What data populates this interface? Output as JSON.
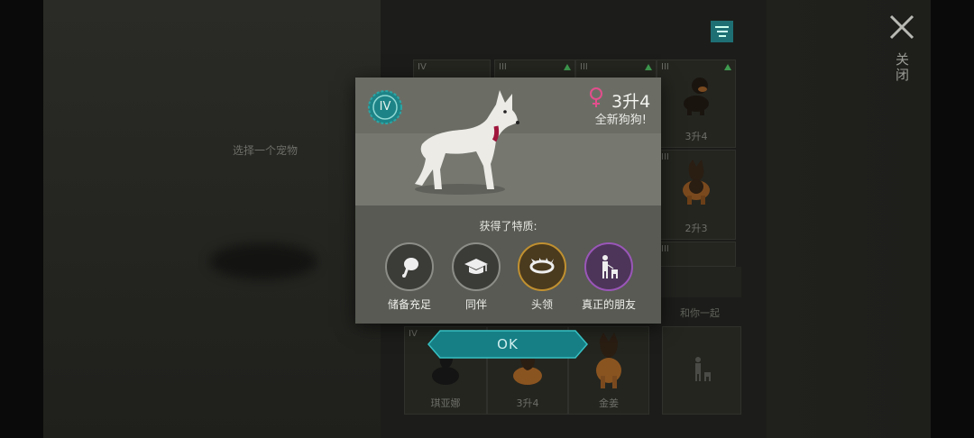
{
  "left": {
    "hint": "选择一个宠物"
  },
  "top_right": {
    "close_label": "关闭"
  },
  "grid": {
    "cards": [
      {
        "tier": "IV",
        "name": ""
      },
      {
        "tier": "III",
        "name": ""
      },
      {
        "tier": "III",
        "name": ""
      },
      {
        "tier": "III",
        "name": "3升4"
      },
      {
        "tier": "III",
        "name": "2升3"
      },
      {
        "tier": "III",
        "name": ""
      },
      {
        "tier": "IV",
        "name": "琪亚娜"
      },
      {
        "tier": "",
        "name": "3升4"
      },
      {
        "tier": "",
        "name": "金姜"
      }
    ],
    "together_label": "和你一起"
  },
  "modal": {
    "tier": "IV",
    "dog_name": "3升4",
    "subtitle": "全新狗狗!",
    "traits_title": "获得了特质:",
    "traits": [
      {
        "label": "储备充足",
        "icon": "meat-icon"
      },
      {
        "label": "同伴",
        "icon": "graduation-cap-icon"
      },
      {
        "label": "头领",
        "icon": "spiked-collar-icon"
      },
      {
        "label": "真正的朋友",
        "icon": "person-with-dog-icon"
      }
    ],
    "ok_label": "OK"
  },
  "colors": {
    "accent_teal": "#1f8f93",
    "leader_ring": "#c09030",
    "friend_ring": "#9a56b8",
    "female_pink": "#e24f8c",
    "upgrade_green": "#3e9a4f"
  }
}
